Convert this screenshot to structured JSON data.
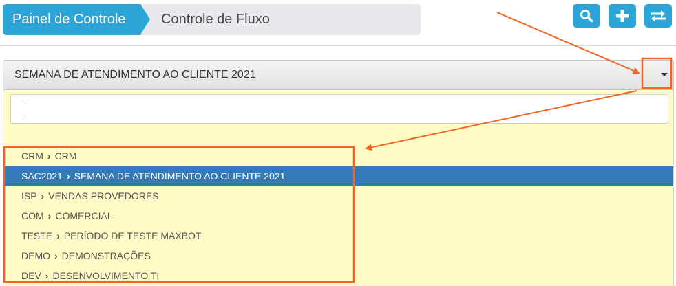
{
  "breadcrumb": {
    "home": "Painel de Controle",
    "current": "Controle de Fluxo"
  },
  "toolbar": {
    "icons": [
      "search-icon",
      "plus-icon",
      "swap-icon"
    ]
  },
  "select": {
    "value": "SEMANA DE ATENDIMENTO AO CLIENTE 2021"
  },
  "search": {
    "value": ""
  },
  "options": [
    {
      "code": "CRM",
      "name": "CRM"
    },
    {
      "code": "SAC2021",
      "name": "SEMANA DE ATENDIMENTO AO CLIENTE 2021",
      "selected": true
    },
    {
      "code": "ISP",
      "name": "VENDAS PROVEDORES"
    },
    {
      "code": "COM",
      "name": "COMERCIAL"
    },
    {
      "code": "TESTE",
      "name": "PERÍODO DE TESTE MAXBOT"
    },
    {
      "code": "DEMO",
      "name": "DEMONSTRAÇÕES"
    },
    {
      "code": "DEV",
      "name": "DESENVOLVIMENTO TI"
    }
  ],
  "colors": {
    "accent": "#2ea5d9",
    "selected": "#337ab7",
    "dropdown_bg": "#fefbc4",
    "annotation": "#f26522"
  }
}
